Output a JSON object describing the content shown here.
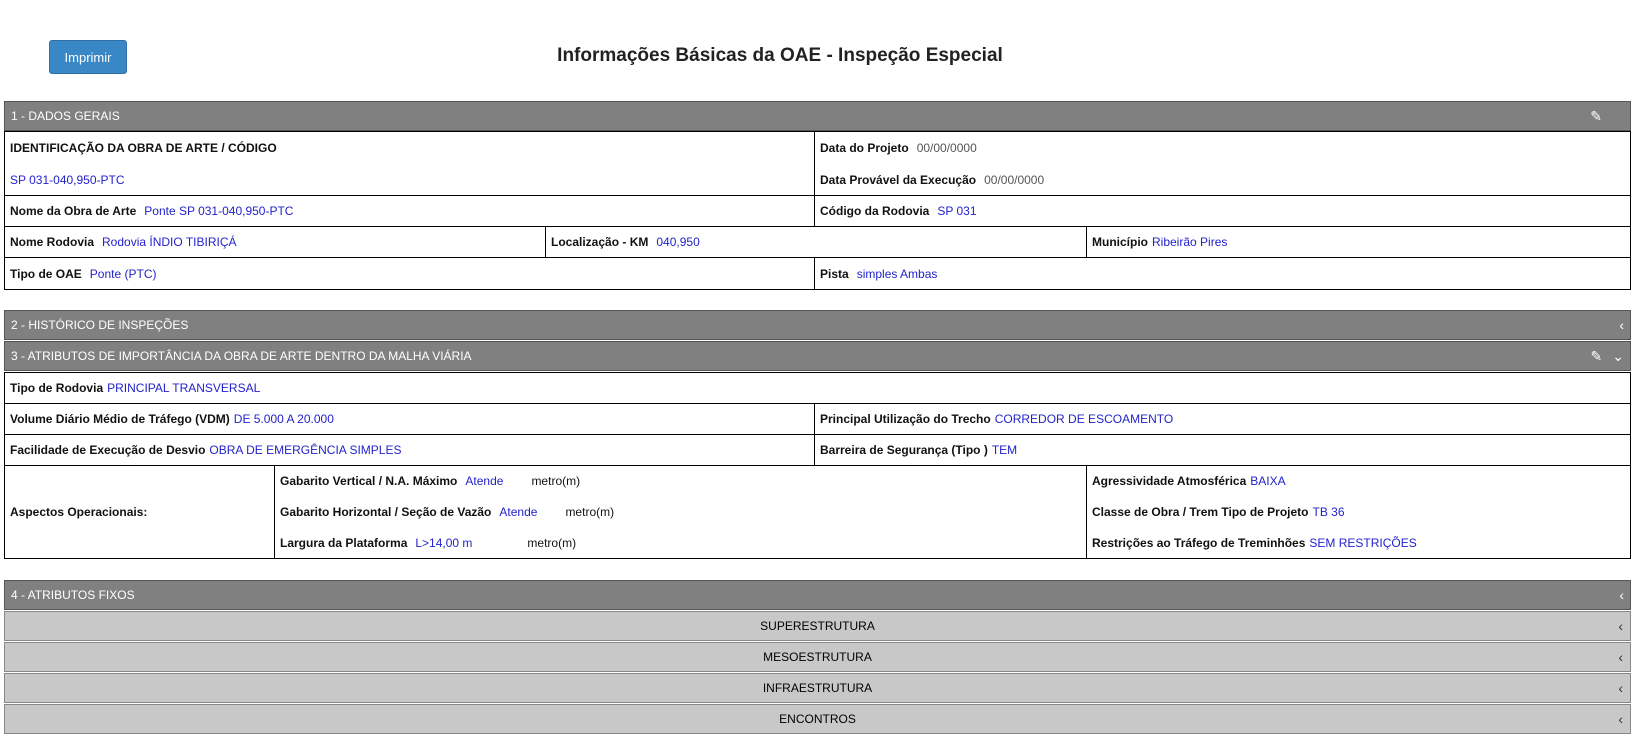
{
  "toolbar": {
    "print_label": "Imprimir"
  },
  "page": {
    "title": "Informações Básicas da OAE - Inspeção Especial"
  },
  "section1": {
    "title": "1 - DADOS GERAIS",
    "ident_label": "IDENTIFICAÇÃO DA OBRA DE ARTE / CÓDIGO",
    "ident_value": "SP 031-040,950-PTC",
    "data_projeto_label": "Data do Projeto",
    "data_projeto_value": "00/00/0000",
    "data_execucao_label": "Data Provável da Execução",
    "data_execucao_value": "00/00/0000",
    "nome_obra_label": "Nome da Obra de Arte",
    "nome_obra_value": "Ponte SP 031-040,950-PTC",
    "codigo_rodovia_label": "Código da Rodovia",
    "codigo_rodovia_value": "SP 031",
    "nome_rodovia_label": "Nome Rodovia",
    "nome_rodovia_value": "Rodovia ÍNDIO TIBIRIÇÁ",
    "localizacao_label": "Localização - KM",
    "localizacao_value": "040,950",
    "municipio_label": "Município",
    "municipio_value": "Ribeirão Pires",
    "tipo_oae_label": "Tipo de OAE",
    "tipo_oae_value": "Ponte (PTC)",
    "pista_label": "Pista",
    "pista_value": "simples Ambas"
  },
  "section2": {
    "title": "2 - HISTÓRICO DE INSPEÇÕES"
  },
  "section3": {
    "title": "3 - ATRIBUTOS DE IMPORTÂNCIA DA OBRA DE ARTE DENTRO DA MALHA VIÁRIA",
    "tipo_rodovia_label": "Tipo de Rodovia",
    "tipo_rodovia_value": "PRINCIPAL TRANSVERSAL",
    "vdm_label": "Volume Diário Médio de Tráfego (VDM)",
    "vdm_value": "DE 5.000 A 20.000",
    "utilizacao_label": "Principal Utilização do Trecho",
    "utilizacao_value": "CORREDOR DE ESCOAMENTO",
    "desvio_label": "Facilidade de Execução de Desvio",
    "desvio_value": "OBRA DE EMERGÊNCIA SIMPLES",
    "barreira_label": "Barreira de Segurança (Tipo )",
    "barreira_value": "TEM",
    "aspectos_label": "Aspectos Operacionais:",
    "gab_vertical_label": "Gabarito Vertical / N.A. Máximo",
    "gab_vertical_value": "Atende",
    "gab_horizontal_label": "Gabarito Horizontal / Seção de Vazão",
    "gab_horizontal_value": "Atende",
    "largura_label": "Largura da Plataforma",
    "largura_value": "L>14,00 m",
    "unit": "metro(m)",
    "agressividade_label": "Agressividade Atmosférica",
    "agressividade_value": "BAIXA",
    "classe_label": "Classe de Obra / Trem Tipo de Projeto",
    "classe_value": "TB 36",
    "restricoes_label": "Restrições ao Tráfego de Treminhões",
    "restricoes_value": "SEM RESTRIÇÕES"
  },
  "section4": {
    "title": "4 - ATRIBUTOS FIXOS",
    "subsections": [
      "SUPERESTRUTURA",
      "MESOESTRUTURA",
      "INFRAESTRUTURA",
      "ENCONTROS"
    ]
  }
}
